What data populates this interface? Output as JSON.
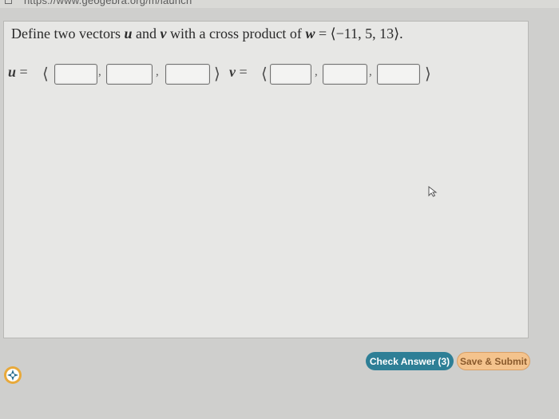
{
  "browser": {
    "url": "https://www.geogebra.org/m/launch"
  },
  "question": {
    "prompt_start": "Define two vectors ",
    "u_symbol": "u",
    "and_text": " and ",
    "v_symbol": "v",
    "mid_text": " with a cross product of ",
    "w_symbol": "w",
    "w_value": " = ⟨−11, 5, 13⟩."
  },
  "vectors": {
    "u": {
      "label": "u",
      "equals": " = ",
      "open": "⟨",
      "close": "⟩",
      "entries": [
        "",
        "",
        ""
      ]
    },
    "v": {
      "label": "v",
      "equals": " = ",
      "open": "⟨",
      "close": "⟩",
      "entries": [
        "",
        "",
        ""
      ]
    },
    "comma": ","
  },
  "buttons": {
    "check_answer": "Check Answer (3)",
    "save_submit": "Save & Submit"
  },
  "colors": {
    "check_button": "#2e7f96",
    "save_button": "#f4c38d"
  },
  "icons": [
    "cursor-arrow-icon",
    "navigation-compass-icon",
    "page-icon"
  ]
}
